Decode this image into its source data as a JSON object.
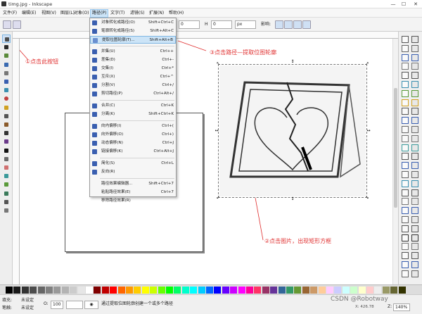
{
  "window": {
    "title": "timg.jpg - Inkscape",
    "min": "—",
    "max": "☐",
    "close": "✕"
  },
  "menubar": {
    "items": [
      "文件(F)",
      "编辑(E)",
      "视图(V)",
      "图层(L)",
      "对象(O)",
      "路径(P)",
      "文字(T)",
      "滤镜(S)",
      "扩展(N)",
      "帮助(H)"
    ],
    "active_index": 5
  },
  "cmdbar": {
    "x_value": "0",
    "unit": "px",
    "h_label": "H",
    "h_value": "0",
    "lock_label": "影响:"
  },
  "path_menu": {
    "items": [
      {
        "label": "对象转化成路径(O)",
        "shortcut": "Shift+Ctrl+C",
        "icon_color": "#3a5fb0"
      },
      {
        "label": "笔廓转化成路径(S)",
        "shortcut": "Shift+Alt+C",
        "icon_color": "#3a5fb0"
      },
      {
        "label": "提取位图轮廓(T)...",
        "shortcut": "Shift+Alt+B",
        "icon_color": "#6a8fd0"
      },
      {
        "label": "并集(U)",
        "shortcut": "Ctrl++",
        "icon_color": "#3a5fb0"
      },
      {
        "label": "差集(D)",
        "shortcut": "Ctrl+-",
        "icon_color": "#3a5fb0"
      },
      {
        "label": "交集(I)",
        "shortcut": "Ctrl+*",
        "icon_color": "#3a5fb0"
      },
      {
        "label": "互斥(X)",
        "shortcut": "Ctrl+^",
        "icon_color": "#3a5fb0"
      },
      {
        "label": "分割(V)",
        "shortcut": "Ctrl+/",
        "icon_color": "#3a5fb0"
      },
      {
        "label": "剪切路径(P)",
        "shortcut": "Ctrl+Alt+/",
        "icon_color": "#3a5fb0"
      },
      {
        "label": "合并(C)",
        "shortcut": "Ctrl+K",
        "icon_color": "#3a5fb0"
      },
      {
        "label": "分离(K)",
        "shortcut": "Shift+Ctrl+K",
        "icon_color": "#3a5fb0"
      },
      {
        "label": "向内偏移(I)",
        "shortcut": "Ctrl+(",
        "icon_color": "#3a5fb0"
      },
      {
        "label": "向外偏移(O)",
        "shortcut": "Ctrl+)",
        "icon_color": "#3a5fb0"
      },
      {
        "label": "动态偏移(N)",
        "shortcut": "Ctrl+J",
        "icon_color": "#3a5fb0"
      },
      {
        "label": "链接偏移(K)",
        "shortcut": "Ctrl+Alt+J",
        "icon_color": "#3a5fb0"
      },
      {
        "label": "简化(S)",
        "shortcut": "Ctrl+L",
        "icon_color": "#3a5fb0"
      },
      {
        "label": "反向(R)",
        "shortcut": "",
        "icon_color": "#3a5fb0"
      },
      {
        "label": "路径效果编辑器...",
        "shortcut": "Shift+Ctrl+7",
        "icon_color": ""
      },
      {
        "label": "粘贴路径效果(E)",
        "shortcut": "Ctrl+7",
        "icon_color": ""
      },
      {
        "label": "移除路径效果(R)",
        "shortcut": "",
        "icon_color": ""
      }
    ],
    "highlight_index": 2
  },
  "annotations": {
    "step1": "①点击此按钮",
    "step2": "②点击图片，出现矩形方框",
    "step3": "③点击路径—提取位图轮廓"
  },
  "statusbar": {
    "fill_label": "填充:",
    "fill_value": "未设定",
    "stroke_label": "笔触:",
    "stroke_value": "未设定",
    "opacity_label": "O:",
    "opacity_value": "100",
    "message": "通过提取位图轮廓创建一个或多个路径",
    "coords": "X: 426.78",
    "zoom_label": "Z:",
    "zoom": "140%"
  },
  "watermark": "CSDN @Robotway",
  "palette_colors": [
    "#000000",
    "#1a1a1a",
    "#333333",
    "#4d4d4d",
    "#666666",
    "#808080",
    "#999999",
    "#b3b3b3",
    "#cccccc",
    "#e6e6e6",
    "#ffffff",
    "#800000",
    "#c00000",
    "#ff0000",
    "#ff6600",
    "#ff9900",
    "#ffcc00",
    "#ffff00",
    "#ccff00",
    "#66ff00",
    "#00ff00",
    "#00ff66",
    "#00ffcc",
    "#00ffff",
    "#00ccff",
    "#0066ff",
    "#0000ff",
    "#6600ff",
    "#cc00ff",
    "#ff00ff",
    "#ff0099",
    "#ff3366",
    "#993366",
    "#663399",
    "#336699",
    "#339966",
    "#669933",
    "#996633",
    "#cc9966",
    "#ffcc99",
    "#ffccff",
    "#ccccff",
    "#ccffff",
    "#ccffcc",
    "#ffffcc",
    "#ffcccc",
    "#eeeeee",
    "#999966",
    "#666633",
    "#333300"
  ]
}
